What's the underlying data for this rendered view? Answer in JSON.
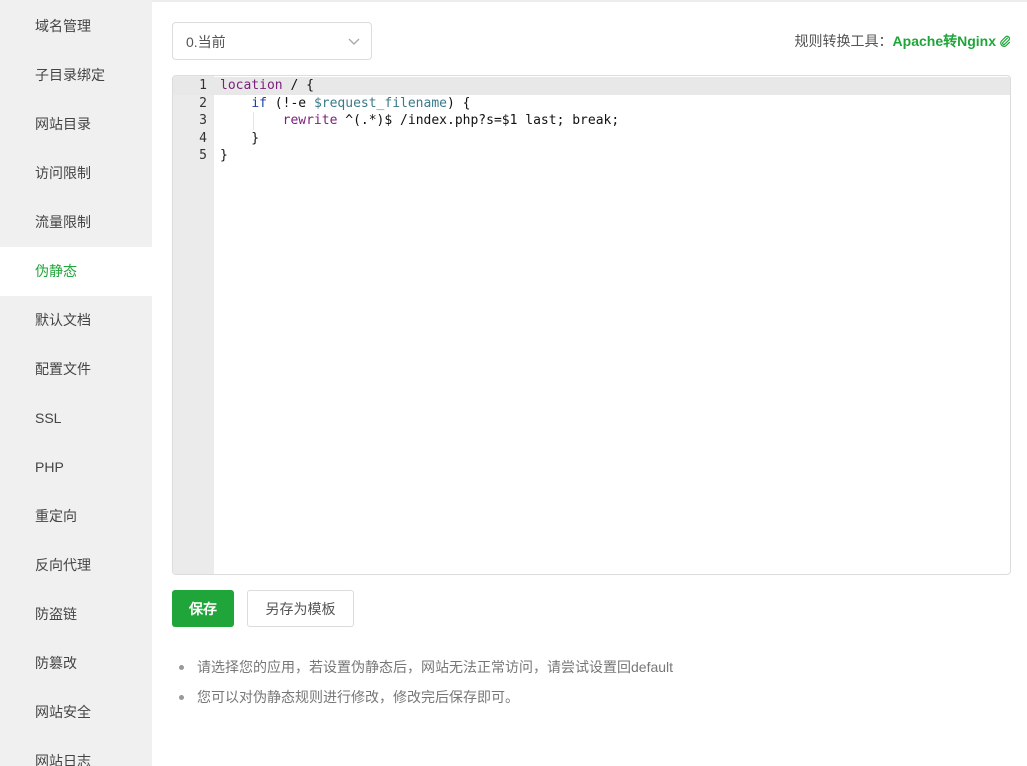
{
  "sidebar": {
    "items": [
      {
        "label": "域名管理"
      },
      {
        "label": "子目录绑定"
      },
      {
        "label": "网站目录"
      },
      {
        "label": "访问限制"
      },
      {
        "label": "流量限制"
      },
      {
        "label": "伪静态",
        "active": true
      },
      {
        "label": "默认文档"
      },
      {
        "label": "配置文件"
      },
      {
        "label": "SSL"
      },
      {
        "label": "PHP"
      },
      {
        "label": "重定向"
      },
      {
        "label": "反向代理"
      },
      {
        "label": "防盗链"
      },
      {
        "label": "防篡改"
      },
      {
        "label": "网站安全"
      },
      {
        "label": "网站日志"
      }
    ]
  },
  "rewrite": {
    "template_select": {
      "value": "0.当前",
      "icon": "chevron-down-icon"
    },
    "tool_label": "规则转换工具：",
    "tool_link": "Apache转Nginx",
    "tool_icon": "paperclip-icon"
  },
  "editor": {
    "line_numbers": [
      "1",
      "2",
      "3",
      "4",
      "5"
    ],
    "lines": [
      "location / {",
      "    if (!-e $request_filename) {",
      "        rewrite ^(.*)$ /index.php?s=$1 last; break;",
      "    }",
      "}"
    ]
  },
  "buttons": {
    "save": "保存",
    "save_as_template": "另存为模板"
  },
  "tips": [
    "请选择您的应用，若设置伪静态后，网站无法正常访问，请尝试设置回default",
    "您可以对伪静态规则进行修改，修改完后保存即可。"
  ],
  "colors": {
    "accent": "#20a53a",
    "sidebar_bg": "#f0f0f0",
    "gutter_bg": "#ebebeb"
  }
}
